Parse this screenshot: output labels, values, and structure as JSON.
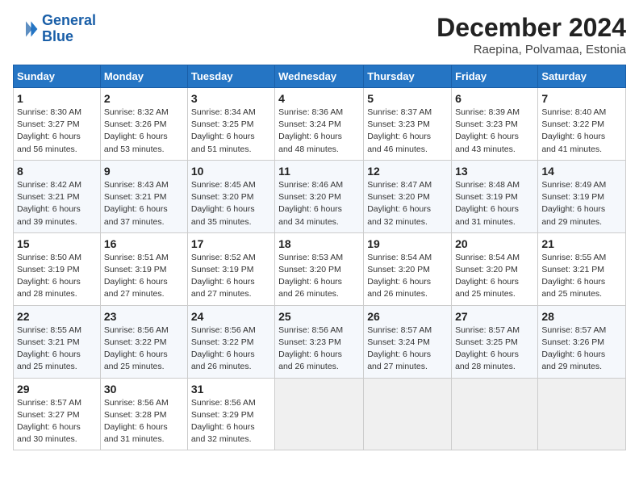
{
  "logo": {
    "line1": "General",
    "line2": "Blue"
  },
  "title": "December 2024",
  "subtitle": "Raepina, Polvamaa, Estonia",
  "weekdays": [
    "Sunday",
    "Monday",
    "Tuesday",
    "Wednesday",
    "Thursday",
    "Friday",
    "Saturday"
  ],
  "weeks": [
    [
      {
        "day": "1",
        "info": "Sunrise: 8:30 AM\nSunset: 3:27 PM\nDaylight: 6 hours\nand 56 minutes."
      },
      {
        "day": "2",
        "info": "Sunrise: 8:32 AM\nSunset: 3:26 PM\nDaylight: 6 hours\nand 53 minutes."
      },
      {
        "day": "3",
        "info": "Sunrise: 8:34 AM\nSunset: 3:25 PM\nDaylight: 6 hours\nand 51 minutes."
      },
      {
        "day": "4",
        "info": "Sunrise: 8:36 AM\nSunset: 3:24 PM\nDaylight: 6 hours\nand 48 minutes."
      },
      {
        "day": "5",
        "info": "Sunrise: 8:37 AM\nSunset: 3:23 PM\nDaylight: 6 hours\nand 46 minutes."
      },
      {
        "day": "6",
        "info": "Sunrise: 8:39 AM\nSunset: 3:23 PM\nDaylight: 6 hours\nand 43 minutes."
      },
      {
        "day": "7",
        "info": "Sunrise: 8:40 AM\nSunset: 3:22 PM\nDaylight: 6 hours\nand 41 minutes."
      }
    ],
    [
      {
        "day": "8",
        "info": "Sunrise: 8:42 AM\nSunset: 3:21 PM\nDaylight: 6 hours\nand 39 minutes."
      },
      {
        "day": "9",
        "info": "Sunrise: 8:43 AM\nSunset: 3:21 PM\nDaylight: 6 hours\nand 37 minutes."
      },
      {
        "day": "10",
        "info": "Sunrise: 8:45 AM\nSunset: 3:20 PM\nDaylight: 6 hours\nand 35 minutes."
      },
      {
        "day": "11",
        "info": "Sunrise: 8:46 AM\nSunset: 3:20 PM\nDaylight: 6 hours\nand 34 minutes."
      },
      {
        "day": "12",
        "info": "Sunrise: 8:47 AM\nSunset: 3:20 PM\nDaylight: 6 hours\nand 32 minutes."
      },
      {
        "day": "13",
        "info": "Sunrise: 8:48 AM\nSunset: 3:19 PM\nDaylight: 6 hours\nand 31 minutes."
      },
      {
        "day": "14",
        "info": "Sunrise: 8:49 AM\nSunset: 3:19 PM\nDaylight: 6 hours\nand 29 minutes."
      }
    ],
    [
      {
        "day": "15",
        "info": "Sunrise: 8:50 AM\nSunset: 3:19 PM\nDaylight: 6 hours\nand 28 minutes."
      },
      {
        "day": "16",
        "info": "Sunrise: 8:51 AM\nSunset: 3:19 PM\nDaylight: 6 hours\nand 27 minutes."
      },
      {
        "day": "17",
        "info": "Sunrise: 8:52 AM\nSunset: 3:19 PM\nDaylight: 6 hours\nand 27 minutes."
      },
      {
        "day": "18",
        "info": "Sunrise: 8:53 AM\nSunset: 3:20 PM\nDaylight: 6 hours\nand 26 minutes."
      },
      {
        "day": "19",
        "info": "Sunrise: 8:54 AM\nSunset: 3:20 PM\nDaylight: 6 hours\nand 26 minutes."
      },
      {
        "day": "20",
        "info": "Sunrise: 8:54 AM\nSunset: 3:20 PM\nDaylight: 6 hours\nand 25 minutes."
      },
      {
        "day": "21",
        "info": "Sunrise: 8:55 AM\nSunset: 3:21 PM\nDaylight: 6 hours\nand 25 minutes."
      }
    ],
    [
      {
        "day": "22",
        "info": "Sunrise: 8:55 AM\nSunset: 3:21 PM\nDaylight: 6 hours\nand 25 minutes."
      },
      {
        "day": "23",
        "info": "Sunrise: 8:56 AM\nSunset: 3:22 PM\nDaylight: 6 hours\nand 25 minutes."
      },
      {
        "day": "24",
        "info": "Sunrise: 8:56 AM\nSunset: 3:22 PM\nDaylight: 6 hours\nand 26 minutes."
      },
      {
        "day": "25",
        "info": "Sunrise: 8:56 AM\nSunset: 3:23 PM\nDaylight: 6 hours\nand 26 minutes."
      },
      {
        "day": "26",
        "info": "Sunrise: 8:57 AM\nSunset: 3:24 PM\nDaylight: 6 hours\nand 27 minutes."
      },
      {
        "day": "27",
        "info": "Sunrise: 8:57 AM\nSunset: 3:25 PM\nDaylight: 6 hours\nand 28 minutes."
      },
      {
        "day": "28",
        "info": "Sunrise: 8:57 AM\nSunset: 3:26 PM\nDaylight: 6 hours\nand 29 minutes."
      }
    ],
    [
      {
        "day": "29",
        "info": "Sunrise: 8:57 AM\nSunset: 3:27 PM\nDaylight: 6 hours\nand 30 minutes."
      },
      {
        "day": "30",
        "info": "Sunrise: 8:56 AM\nSunset: 3:28 PM\nDaylight: 6 hours\nand 31 minutes."
      },
      {
        "day": "31",
        "info": "Sunrise: 8:56 AM\nSunset: 3:29 PM\nDaylight: 6 hours\nand 32 minutes."
      },
      null,
      null,
      null,
      null
    ]
  ]
}
